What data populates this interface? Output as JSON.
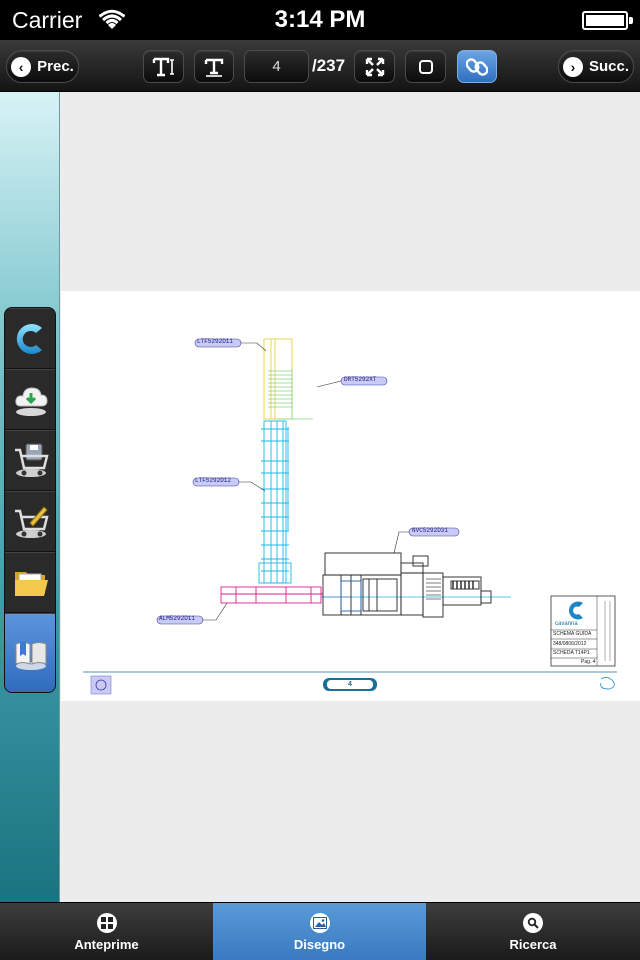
{
  "status_bar": {
    "carrier": "Carrier",
    "time": "3:14 PM"
  },
  "toolbar": {
    "prev_label": "Prec.",
    "next_label": "Succ.",
    "current_page": "4",
    "total_pages": "/237"
  },
  "sidebar": {
    "items": [
      "logo-icon",
      "cloud-download-icon",
      "cart-save-icon",
      "cart-edit-icon",
      "folder-icon",
      "book-icon"
    ],
    "active_index": 5
  },
  "document": {
    "labels": {
      "top_left": "LTF5292D11",
      "top_right": "DRT5292XT",
      "mid_left": "LTF5292D12",
      "right_unit": "NVC5292D31",
      "bottom_left": "ALM5292D11"
    },
    "title_block": {
      "brand": "cavanna",
      "line1": "SCHEMA GUIDA",
      "line2": "348/0806/2012",
      "line3": "SCHEDA T14P1",
      "line4": "Pag. 4"
    },
    "footer_page": "4"
  },
  "tabbar": {
    "tabs": [
      {
        "label": "Anteprime",
        "icon": "grid-icon"
      },
      {
        "label": "Disegno",
        "icon": "image-icon"
      },
      {
        "label": "Ricerca",
        "icon": "search-icon"
      }
    ],
    "active_index": 1
  },
  "colors": {
    "accent": "#3879c0",
    "drawing_cyan": "#1fb6e8",
    "drawing_green": "#7fd87f",
    "drawing_magenta": "#e0208a",
    "label_bg": "#c9cbf5"
  }
}
